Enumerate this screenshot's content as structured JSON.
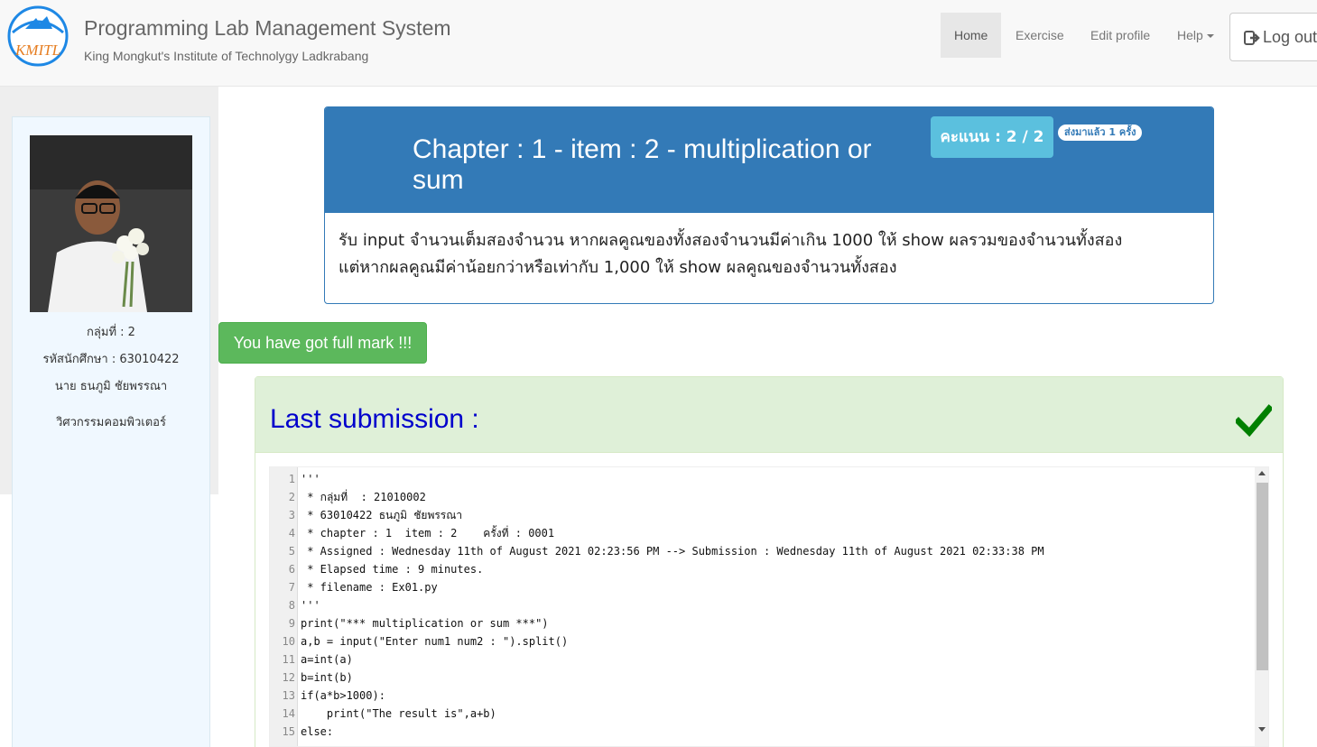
{
  "navbar": {
    "brand_title": "Programming Lab Management System",
    "brand_subtitle": "King Mongkut's Institute of Technolygy Ladkrabang",
    "logo_text": "KMITL",
    "items": [
      {
        "label": "Home",
        "active": true
      },
      {
        "label": "Exercise"
      },
      {
        "label": "Edit profile"
      },
      {
        "label": "Help"
      }
    ],
    "logout_label": "Log out"
  },
  "profile": {
    "group": "กลุ่มที่ : 2",
    "student_id": "รหัสนักศึกษา : 63010422",
    "name": "นาย ธนภูมิ ชัยพรรณา",
    "major": "วิศวกรรมคอมพิวเตอร์"
  },
  "exercise": {
    "title": "Chapter : 1 - item : 2 - multiplication or sum",
    "score": "คะแนน : 2 / 2",
    "submitted": "ส่งมาแล้ว 1 ครั้ง",
    "description_line1": "รับ input จำนวนเต็มสองจำนวน หากผลคูณของทั้งสองจำนวนมีค่าเกิน 1000 ให้ show ผลรวมของจำนวนทั้งสอง",
    "description_line2": "แต่หากผลคูณมีค่าน้อยกว่าหรือเท่ากับ 1,000 ให้ show ผลคูณของจำนวนทั้งสอง"
  },
  "fullmark_label": "You have got full mark !!!",
  "submission": {
    "title": "Last submission :",
    "status_icon": "check-icon",
    "code_lines": [
      "'''",
      " * กลุ่มที่  : 21010002",
      " * 63010422 ธนภูมิ ชัยพรรณา",
      " * chapter : 1  item : 2    ครั้งที่ : 0001",
      " * Assigned : Wednesday 11th of August 2021 02:23:56 PM --> Submission : Wednesday 11th of August 2021 02:33:38 PM",
      " * Elapsed time : 9 minutes.",
      " * filename : Ex01.py",
      "'''",
      "print(\"*** multiplication or sum ***\")",
      "a,b = input(\"Enter num1 num2 : \").split()",
      "a=int(a)",
      "b=int(b)",
      "if(a*b>1000):",
      "    print(\"The result is\",a+b)",
      "else:"
    ],
    "line_numbers": [
      "1",
      "2",
      "3",
      "4",
      "5",
      "6",
      "7",
      "8",
      "9",
      "10",
      "11",
      "12",
      "13",
      "14",
      "15"
    ]
  },
  "colors": {
    "primary": "#337ab7",
    "info": "#5bc0de",
    "success": "#5cb85c",
    "success_bg": "#dff0d8",
    "check": "#008000"
  }
}
